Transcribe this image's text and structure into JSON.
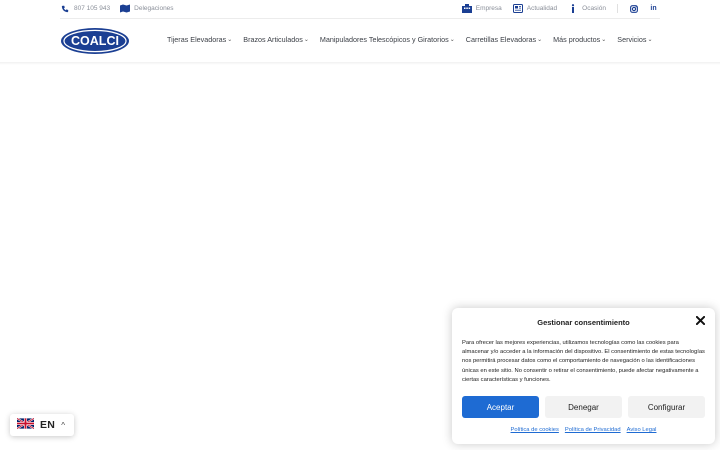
{
  "topbar": {
    "phone": "807 105 943",
    "delegaciones": "Delegaciones",
    "empresa": "Empresa",
    "actualidad": "Actualidad",
    "ocasion": "Ocasión",
    "linkedin": "in"
  },
  "logo": {
    "text": "COALCI"
  },
  "nav": {
    "items": [
      "Tijeras Elevadoras",
      "Brazos Articulados",
      "Manipuladores Telescópicos y Giratorios",
      "Carretillas Elevadoras",
      "Más productos",
      "Servicios"
    ]
  },
  "language": {
    "code": "EN"
  },
  "cookie": {
    "title": "Gestionar consentimiento",
    "body": "Para ofrecer las mejores experiencias, utilizamos tecnologías como las cookies para almacenar y/o acceder a la información del dispositivo. El consentimiento de estas tecnologías nos permitirá procesar datos como el comportamiento de navegación o las identificaciones únicas en este sitio. No consentir o retirar el consentimiento, puede afectar negativamente a ciertas características y funciones.",
    "accept": "Aceptar",
    "deny": "Denegar",
    "configure": "Configurar",
    "links": [
      "Política de cookies",
      "Política de Privacidad",
      "Aviso Legal"
    ]
  },
  "colors": {
    "brand": "#1b3f93",
    "accept": "#1e6bd3"
  }
}
